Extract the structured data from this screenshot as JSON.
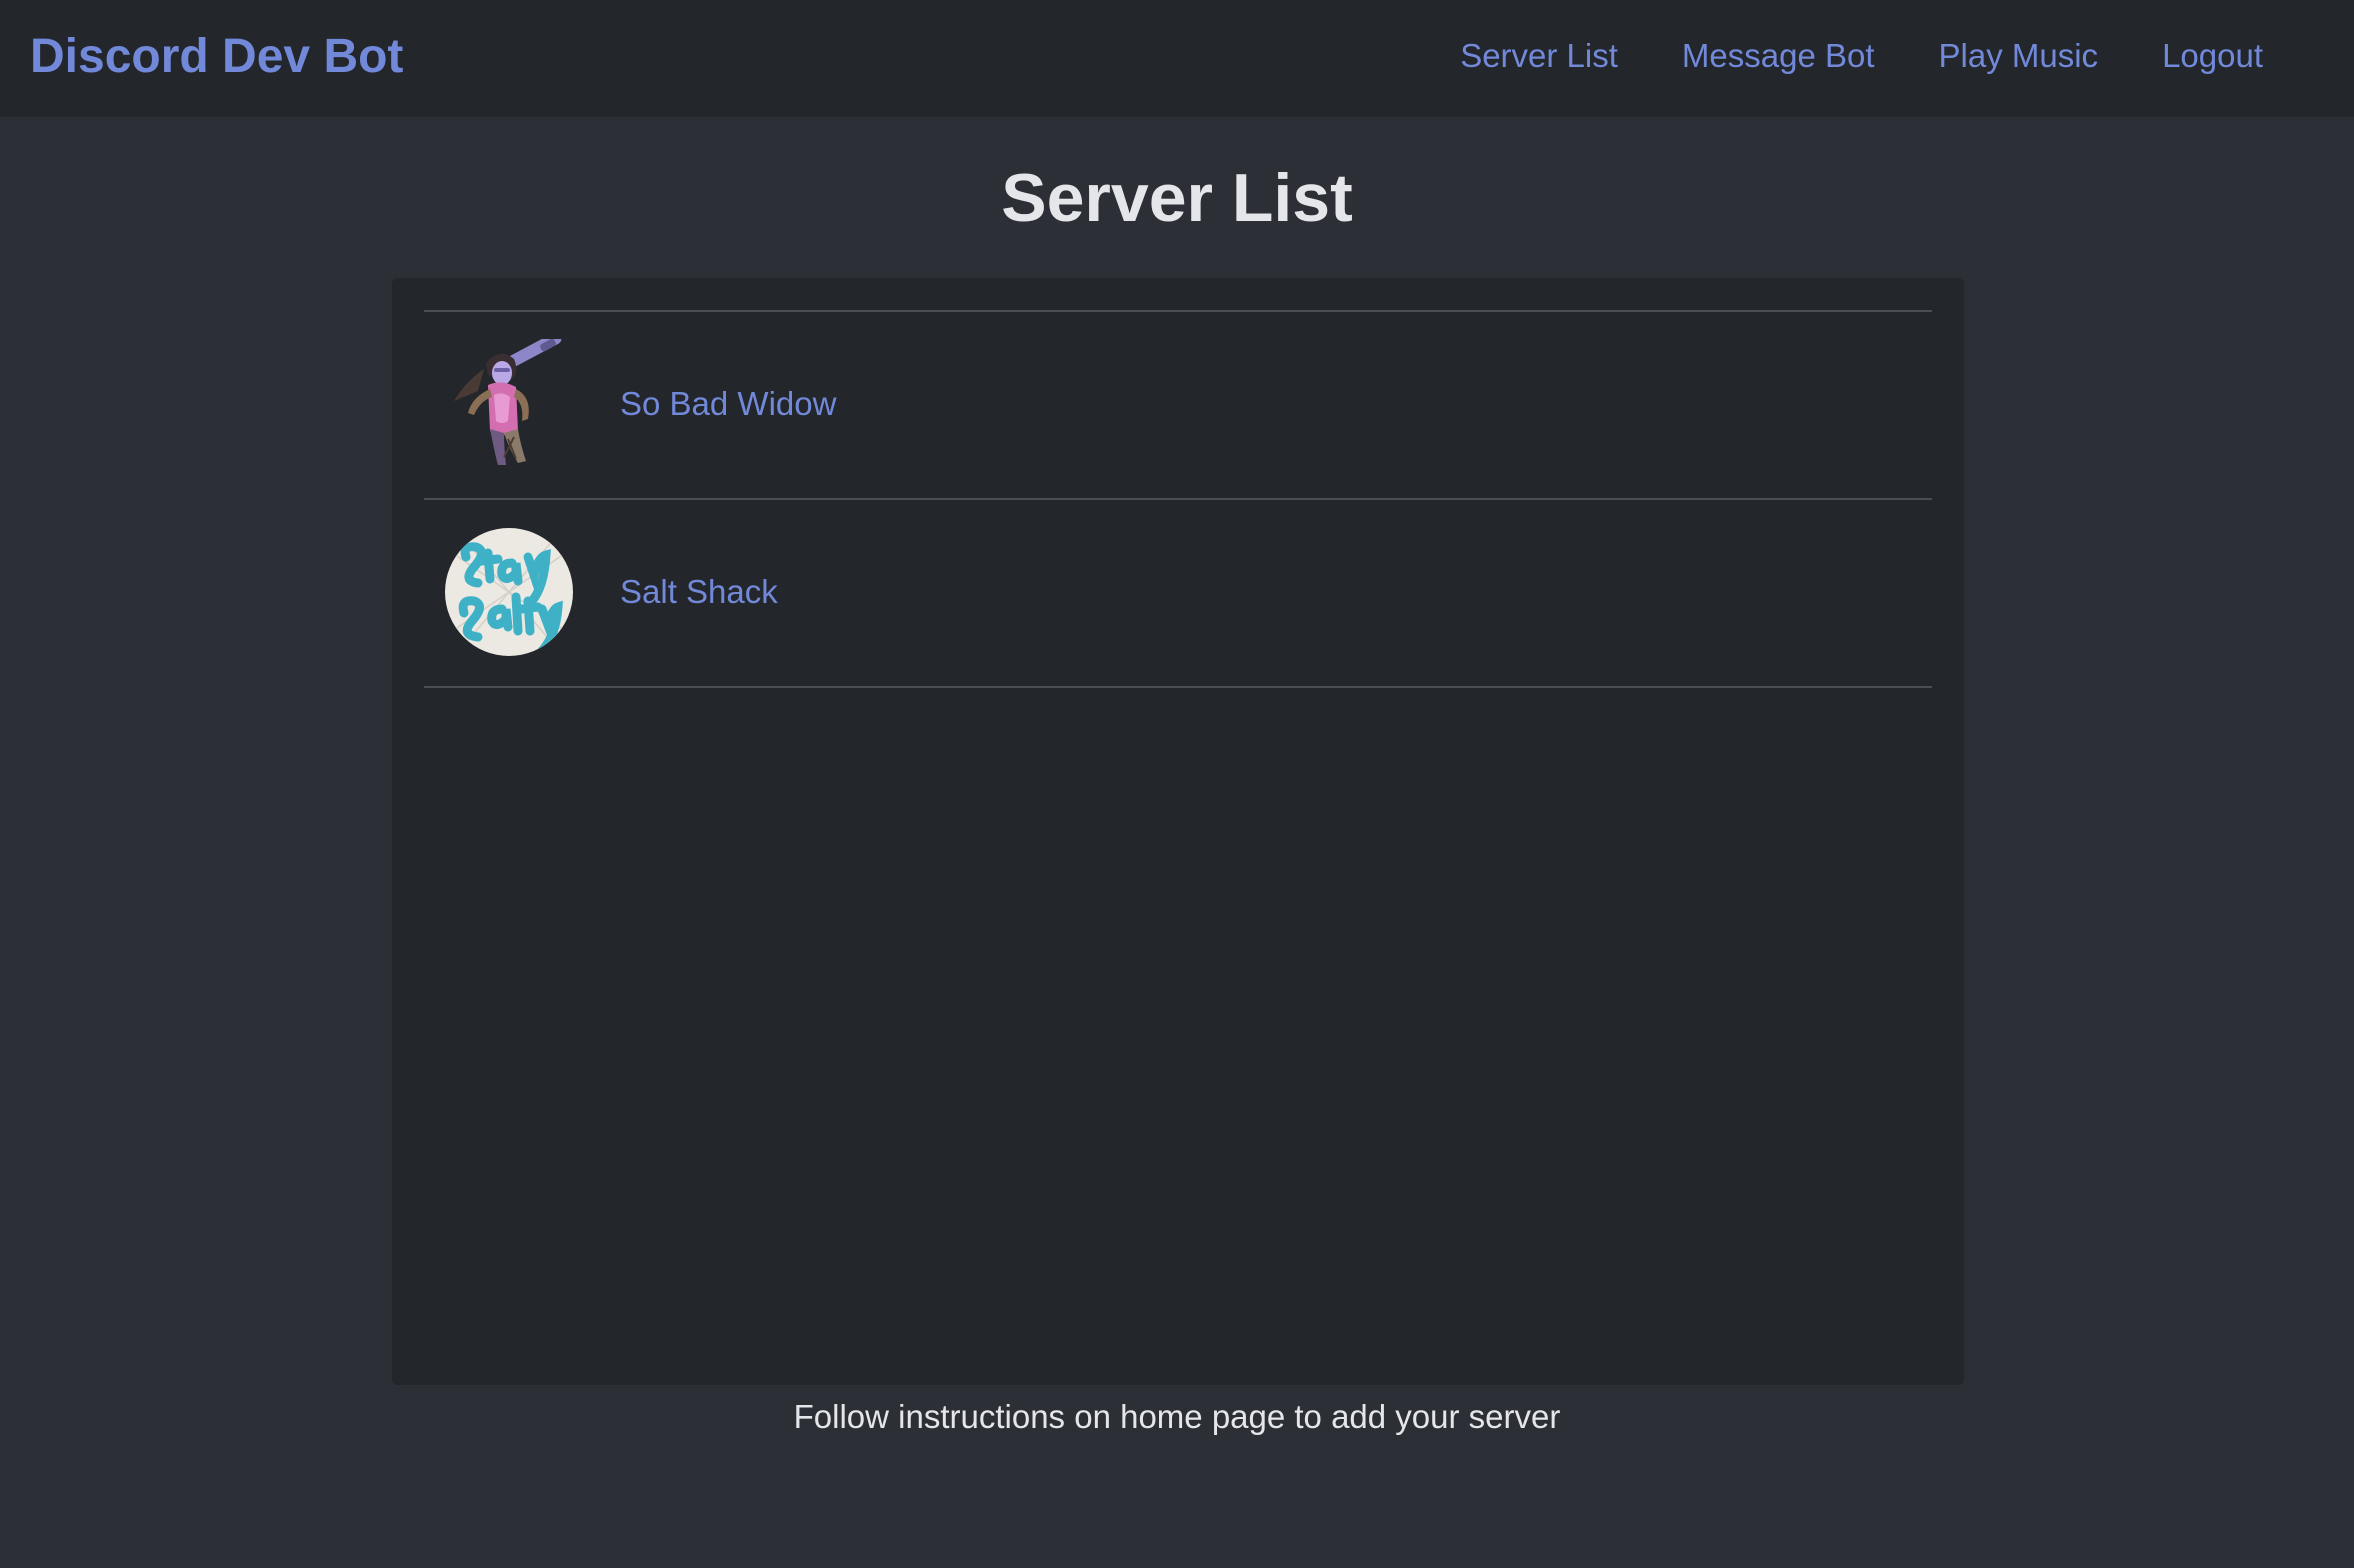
{
  "navbar": {
    "brand": "Discord Dev Bot",
    "links": [
      {
        "label": "Server List"
      },
      {
        "label": "Message Bot"
      },
      {
        "label": "Play Music"
      },
      {
        "label": "Logout"
      }
    ]
  },
  "page": {
    "title": "Server List",
    "footer_note": "Follow instructions on home page to add your server"
  },
  "servers": [
    {
      "name": "So Bad Widow",
      "icon": "widow-character-avatar-icon"
    },
    {
      "name": "Salt Shack",
      "icon": "stay-salty-lettering-avatar-icon"
    }
  ],
  "colors": {
    "background": "#2c2f35",
    "navbar": "#23262a",
    "panel": "#23262a",
    "accent": "#7289da",
    "text": "#e4e6ea",
    "divider": "#4a4d52"
  }
}
